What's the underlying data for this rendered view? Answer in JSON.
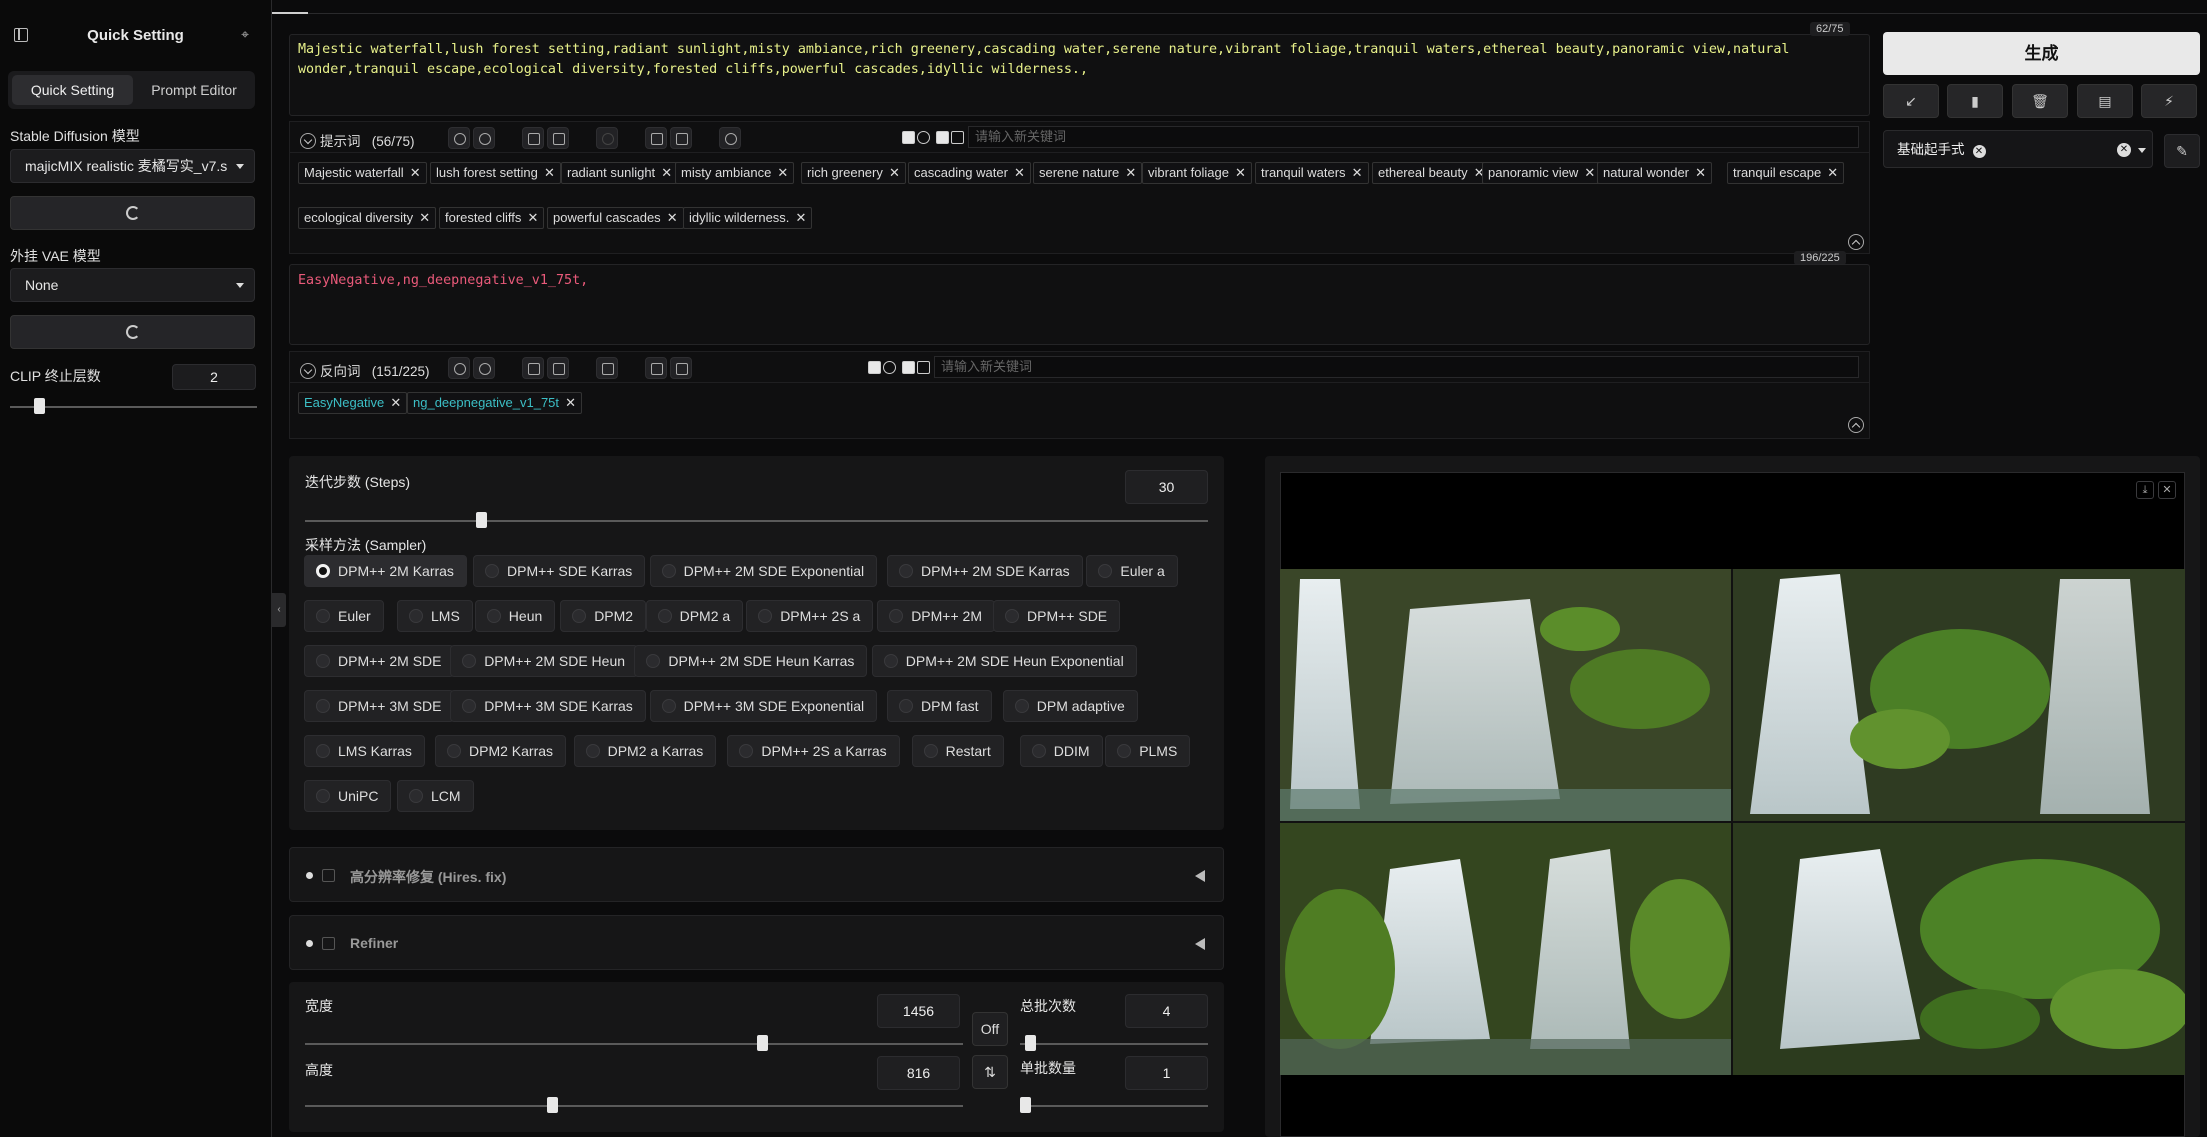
{
  "sidebar": {
    "title": "Quick Setting",
    "tabs": [
      {
        "label": "Quick Setting"
      },
      {
        "label": "Prompt Editor"
      }
    ],
    "sd_model_label": "Stable Diffusion 模型",
    "sd_model_value": "majicMIX realistic 麦橘写实_v7.s",
    "vae_label": "外挂 VAE 模型",
    "vae_value": "None",
    "clip_label": "CLIP 终止层数",
    "clip_value": "2",
    "clip_level": 2
  },
  "prompt": {
    "text": "Majestic waterfall,lush forest setting,radiant sunlight,misty ambiance,rich greenery,cascading water,serene nature,vibrant foliage,tranquil waters,ethereal beauty,panoramic view,natural wonder,tranquil escape,ecological diversity,forested cliffs,powerful cascades,idyllic wilderness.,",
    "counter": "62/75",
    "toggle_label": "提示词",
    "token_count": "(56/75)",
    "keyword_placeholder": "请输入新关键词",
    "tags": [
      "Majestic waterfall",
      "lush forest setting",
      "radiant sunlight",
      "misty ambiance",
      "rich greenery",
      "cascading water",
      "serene nature",
      "vibrant foliage",
      "tranquil waters",
      "ethereal beauty",
      "panoramic view",
      "natural wonder",
      "tranquil escape",
      "ecological diversity",
      "forested cliffs",
      "powerful cascades",
      "idyllic wilderness."
    ]
  },
  "negative": {
    "text": "EasyNegative,ng_deepnegative_v1_75t,",
    "counter": "196/225",
    "toggle_label": "反向词",
    "token_count": "(151/225)",
    "keyword_placeholder": "请输入新关键词",
    "tags": [
      "EasyNegative",
      "ng_deepnegative_v1_75t"
    ]
  },
  "right": {
    "generate_label": "生成",
    "style_chip": "基础起手式"
  },
  "params": {
    "steps_label": "迭代步数 (Steps)",
    "steps_value": "30",
    "steps_min": 1,
    "steps_max": 150,
    "sampler_label": "采样方法 (Sampler)",
    "samplers": [
      "DPM++ 2M Karras",
      "DPM++ SDE Karras",
      "DPM++ 2M SDE Exponential",
      "DPM++ 2M SDE Karras",
      "Euler a",
      "Euler",
      "LMS",
      "Heun",
      "DPM2",
      "DPM2 a",
      "DPM++ 2S a",
      "DPM++ 2M",
      "DPM++ SDE",
      "DPM++ 2M SDE",
      "DPM++ 2M SDE Heun",
      "DPM++ 2M SDE Heun Karras",
      "DPM++ 2M SDE Heun Exponential",
      "DPM++ 3M SDE",
      "DPM++ 3M SDE Karras",
      "DPM++ 3M SDE Exponential",
      "DPM fast",
      "DPM adaptive",
      "LMS Karras",
      "DPM2 Karras",
      "DPM2 a Karras",
      "DPM++ 2S a Karras",
      "Restart",
      "DDIM",
      "PLMS",
      "UniPC",
      "LCM"
    ],
    "selected_sampler": "DPM++ 2M Karras"
  },
  "accordions": {
    "hires_label": "高分辨率修复 (Hires. fix)",
    "refiner_label": "Refiner"
  },
  "size": {
    "width_label": "宽度",
    "width_value": "1456",
    "height_label": "高度",
    "height_value": "816",
    "off_label": "Off",
    "batch_count_label": "总批次数",
    "batch_count_value": "4",
    "batch_size_label": "单批数量",
    "batch_size_value": "1"
  },
  "colors": {
    "prompt_text": "#e7f08a",
    "negative_text": "#ea5a7a",
    "negative_tag": "#3cbfc6"
  }
}
